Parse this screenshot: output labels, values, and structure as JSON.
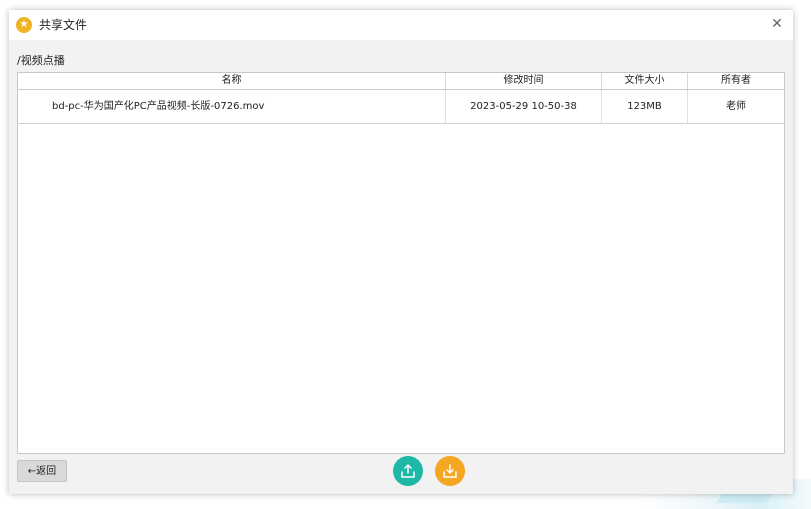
{
  "dialog": {
    "title": "共享文件",
    "title_icon": "star-icon",
    "close_icon": "close-icon",
    "close_symbol": "✕"
  },
  "path": "/视频点播",
  "table": {
    "columns": [
      "名称",
      "修改时间",
      "文件大小",
      "所有者"
    ],
    "rows": [
      {
        "name": "bd-pc-华为国产化PC产品视频-长版-0726.mov",
        "modified": "2023-05-29 10-50-38",
        "size": "123MB",
        "owner": "老师"
      }
    ]
  },
  "footer": {
    "back_label": "←返回",
    "upload_icon": "upload-icon",
    "download_icon": "download-icon"
  },
  "colors": {
    "upload": "#1fb8a6",
    "download": "#f5a623",
    "title_icon": "#f0b323"
  }
}
